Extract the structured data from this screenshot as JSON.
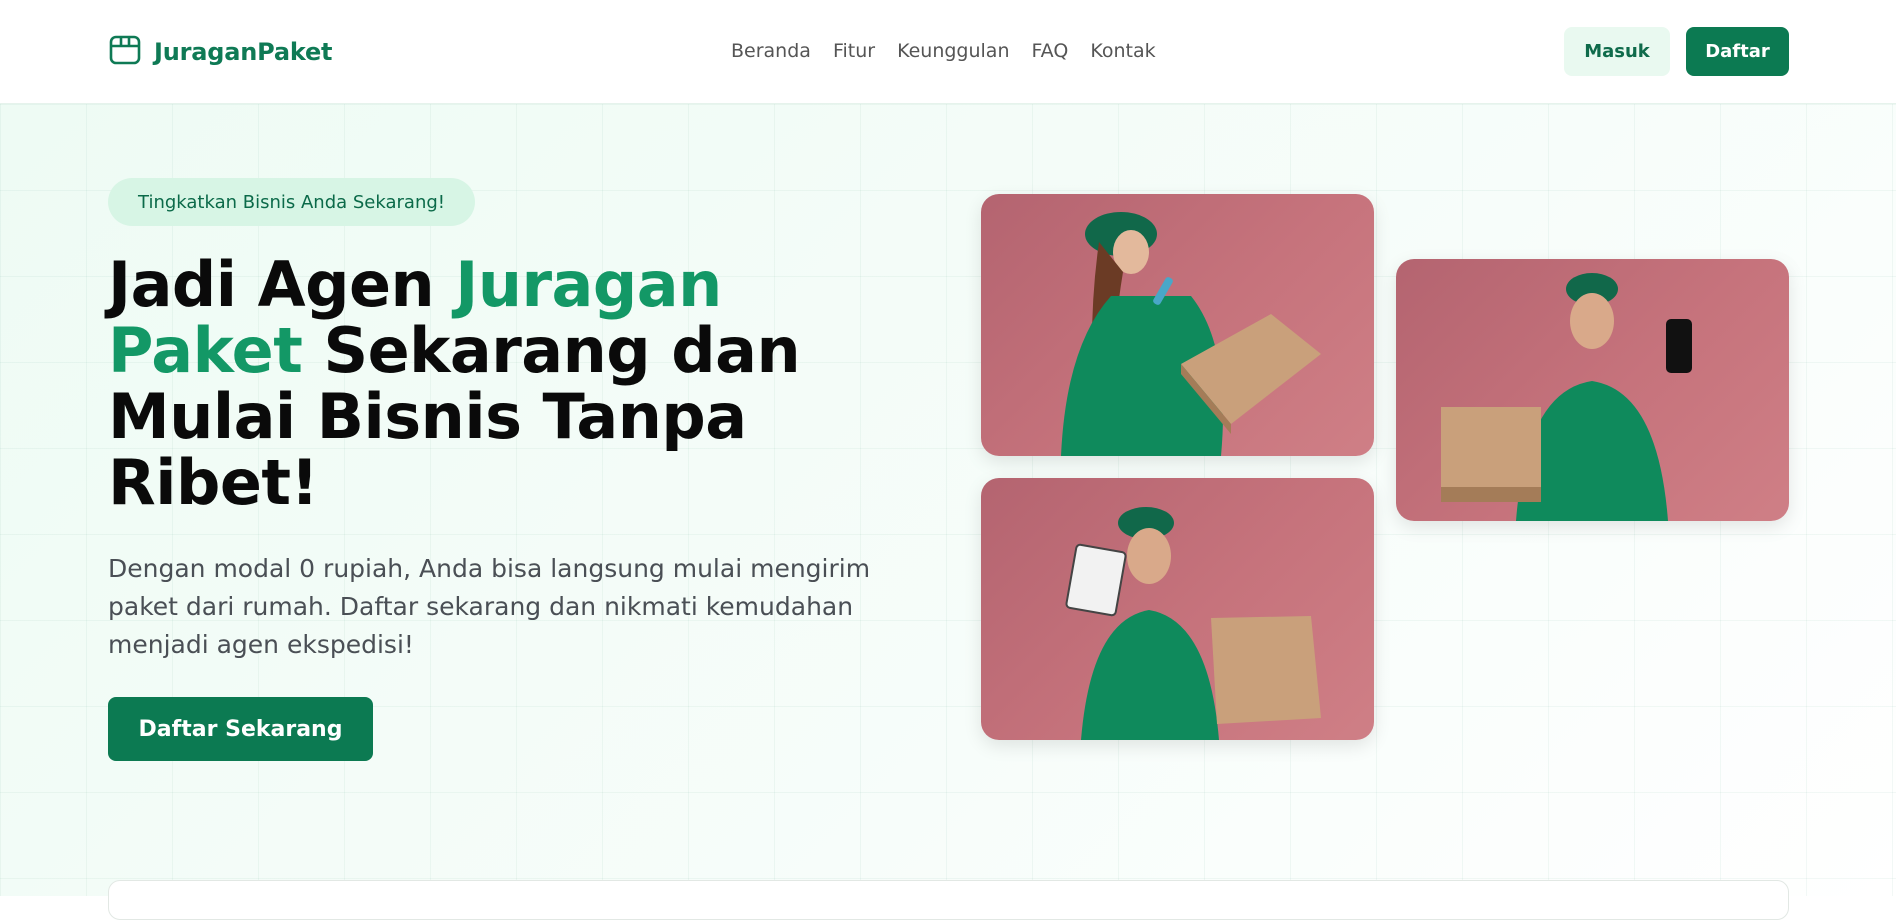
{
  "brand": {
    "name": "JuraganPaket",
    "logo_icon": "package-box-icon",
    "color": "#0f7a55"
  },
  "nav": {
    "items": [
      "Beranda",
      "Fitur",
      "Keunggulan",
      "FAQ",
      "Kontak"
    ]
  },
  "header_buttons": {
    "login": "Masuk",
    "register": "Daftar"
  },
  "hero": {
    "badge": "Tingkatkan Bisnis Anda Sekarang!",
    "headline_part1": "Jadi Agen ",
    "headline_highlight": "Juragan Paket",
    "headline_part2": " Sekarang dan Mulai Bisnis Tanpa Ribet!",
    "subtext": "Dengan modal 0 rupiah, Anda bisa langsung mulai mengirim paket dari rumah. Daftar sekarang dan nikmati kemudahan menjadi agen ekspedisi!",
    "cta": "Daftar Sekarang"
  },
  "colors": {
    "primary": "#0c7a52",
    "accent": "#139866",
    "badge_bg": "#d7f5e5",
    "photo_bg": "#c6737c"
  }
}
